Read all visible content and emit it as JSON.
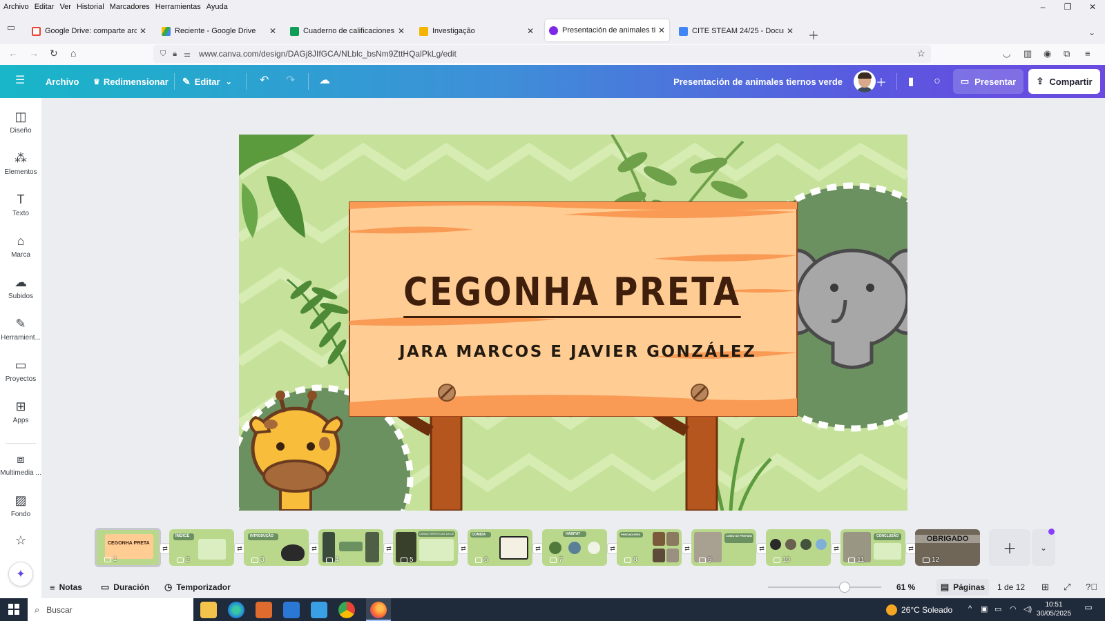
{
  "menubar": {
    "items": [
      "Archivo",
      "Editar",
      "Ver",
      "Historial",
      "Marcadores",
      "Herramientas",
      "Ayuda"
    ],
    "window_controls": [
      "–",
      "❐",
      "✕"
    ]
  },
  "tabs": [
    {
      "title": "Google Drive: comparte archivo",
      "favicon_color": "#ea4335",
      "active": false
    },
    {
      "title": "Reciente - Google Drive",
      "favicon_color": "#1fa463",
      "active": false
    },
    {
      "title": "Cuaderno de calificaciones de 4",
      "favicon_color": "#0f9d58",
      "active": false
    },
    {
      "title": "Investigação",
      "favicon_color": "#f4b400",
      "active": false
    },
    {
      "title": "Presentación de animales tierno",
      "favicon_color": "#7d2ae8",
      "active": true
    },
    {
      "title": "CITE STEAM 24/25 - Document",
      "favicon_color": "#4285f4",
      "active": false
    }
  ],
  "nav": {
    "url": "www.canva.com/design/DAGj8JIfGCA/NLblc_bsNm9ZttHQalPkLg/edit"
  },
  "canva_header": {
    "archivo": "Archivo",
    "redimensionar": "Redimensionar",
    "editar": "Editar",
    "design_title": "Presentación de animales tiernos verde",
    "presentar": "Presentar",
    "compartir": "Compartir"
  },
  "sidebar": {
    "items": [
      {
        "label": "Diseño",
        "icon": "layout-icon"
      },
      {
        "label": "Elementos",
        "icon": "shapes-icon"
      },
      {
        "label": "Texto",
        "icon": "text-icon"
      },
      {
        "label": "Marca",
        "icon": "brand-icon"
      },
      {
        "label": "Subidos",
        "icon": "upload-cloud-icon"
      },
      {
        "label": "Herramient...",
        "icon": "draw-icon"
      },
      {
        "label": "Proyectos",
        "icon": "folder-icon"
      },
      {
        "label": "Apps",
        "icon": "apps-icon"
      },
      {
        "label": "Multimedia ...",
        "icon": "media-icon"
      },
      {
        "label": "Fondo",
        "icon": "background-icon"
      }
    ]
  },
  "slide": {
    "title": "CEGONHA PRETA",
    "subtitle": "JARA MARCOS E JAVIER GONZÁLEZ",
    "colors": {
      "background": "#c6e29a",
      "sign": "#ffcc94",
      "title": "#3f1f0c",
      "circle": "#6c9160"
    }
  },
  "pages": {
    "thumbnails": [
      {
        "num": "1",
        "label": "CEGONHA PRETA",
        "active": true
      },
      {
        "num": "2",
        "label": "ÍNDICE"
      },
      {
        "num": "3",
        "label": "INTRODUÇÃO"
      },
      {
        "num": "4",
        "label": ""
      },
      {
        "num": "5",
        "label": "CARACTERÍSTICAS DA CEGONHA PRETA"
      },
      {
        "num": "6",
        "label": "COMIDA"
      },
      {
        "num": "7",
        "label": "HABITAT"
      },
      {
        "num": "8",
        "label": "PREDADORES"
      },
      {
        "num": "9",
        "label": "COMO SE PREPARA"
      },
      {
        "num": "10",
        "label": ""
      },
      {
        "num": "11",
        "label": "CONCLUSÃO"
      },
      {
        "num": "12",
        "label": "OBRIGADO"
      }
    ]
  },
  "footer": {
    "notas": "Notas",
    "duracion": "Duración",
    "temporizador": "Temporizador",
    "zoom": "61 %",
    "zoom_fraction": 0.61,
    "paginas": "Páginas",
    "page_count": "1 de 12"
  },
  "taskbar": {
    "search": "Buscar",
    "weather": "26°C Soleado",
    "time": "10:51",
    "date": "30/05/2025"
  }
}
